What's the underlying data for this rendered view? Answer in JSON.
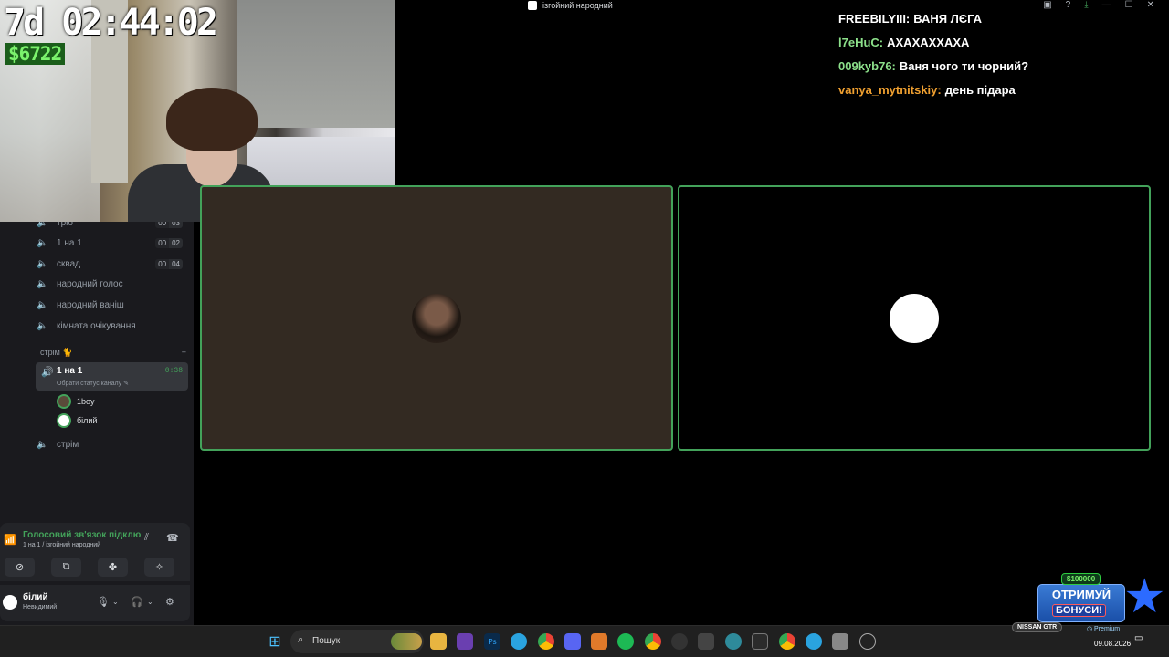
{
  "window": {
    "title": "ізгойний народний"
  },
  "overlay": {
    "timer": "7d 02:44:02",
    "money": "$6722"
  },
  "channels": [
    {
      "label": "тріо",
      "count_a": "00",
      "count_b": "03"
    },
    {
      "label": "1 на 1",
      "count_a": "00",
      "count_b": "02"
    },
    {
      "label": "сквад",
      "count_a": "00",
      "count_b": "04"
    },
    {
      "label": "народний голос"
    },
    {
      "label": "народний ваніш"
    },
    {
      "label": "кімната очікування"
    }
  ],
  "category": {
    "label": "стрім 🐈",
    "add": "+"
  },
  "active_channel": {
    "label": "1 на 1",
    "time": "0:38",
    "status": "Обрати статус каналу ✎"
  },
  "voice_users": [
    {
      "name": "1boy"
    },
    {
      "name": "білий"
    }
  ],
  "stream_channel": {
    "label": "стрім"
  },
  "voice_panel": {
    "status": "Голосовий зв'язок підклю",
    "sub": "1 на 1 / ізгойний народний"
  },
  "user_panel": {
    "name": "білий",
    "state": "Невидимий"
  },
  "chat": [
    {
      "user": "FREEBILYIII:",
      "text": "ВАНЯ ЛЄГА",
      "color": "#ffffff"
    },
    {
      "user": "l7eHuC:",
      "text": "АХАХАХХАХА",
      "color": "#8ce08a"
    },
    {
      "user": "009kyb76:",
      "text": "Ваня чого ти чорний?",
      "color": "#8ce08a"
    },
    {
      "user": "vanya_mytnitskiy:",
      "text": "день підара",
      "color": "#f0a030"
    }
  ],
  "promo": {
    "amount": "$100000",
    "line1": "ОТРИМУЙ",
    "line2": "БОНУСИ!"
  },
  "taskbar": {
    "search": "Пошук",
    "tray_pill": "NISSAN GTR",
    "premium": "◷ Premium",
    "date": "09.08.2026"
  },
  "icons": {
    "speaker": "speaker-icon",
    "signal": "signal-icon",
    "mic": "microphone-icon",
    "headset": "headset-icon",
    "settings": "gear-icon"
  },
  "colors": {
    "accent_green": "#43a25a",
    "tile_left": "#332a22"
  }
}
